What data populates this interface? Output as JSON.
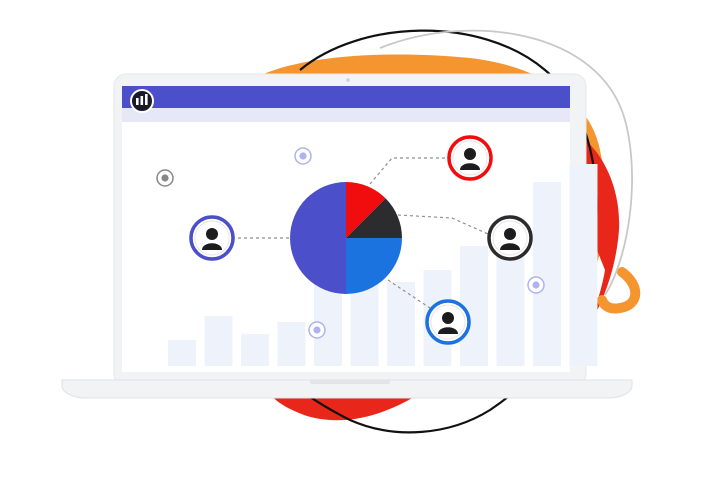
{
  "colors": {
    "background": "#ffffff",
    "orange": "#f5952f",
    "red": "#e8261a",
    "header_bar": "#4b4fc9",
    "subheader_bar": "#e7e8f7",
    "laptop_frame": "#f2f3f5",
    "screen_bg": "#ffffff",
    "bars": "#eef3fb",
    "pie_purple": "#4b4fc9",
    "pie_red": "#f10d0d",
    "pie_dark": "#2c2c2e",
    "pie_blue": "#1b73e0",
    "connector": "#8f8f8f"
  },
  "icons": {
    "logo": "bar-logo-icon",
    "avatar": "user-avatar-icon",
    "dot": "target-dot-icon"
  },
  "pie": [
    {
      "label": "purple",
      "value": 50
    },
    {
      "label": "red",
      "value": 12.5
    },
    {
      "label": "dark",
      "value": 12.5
    },
    {
      "label": "blue",
      "value": 25
    }
  ],
  "bars": [
    26,
    50,
    32,
    44,
    96,
    120,
    84,
    96,
    120,
    140,
    184,
    202
  ]
}
